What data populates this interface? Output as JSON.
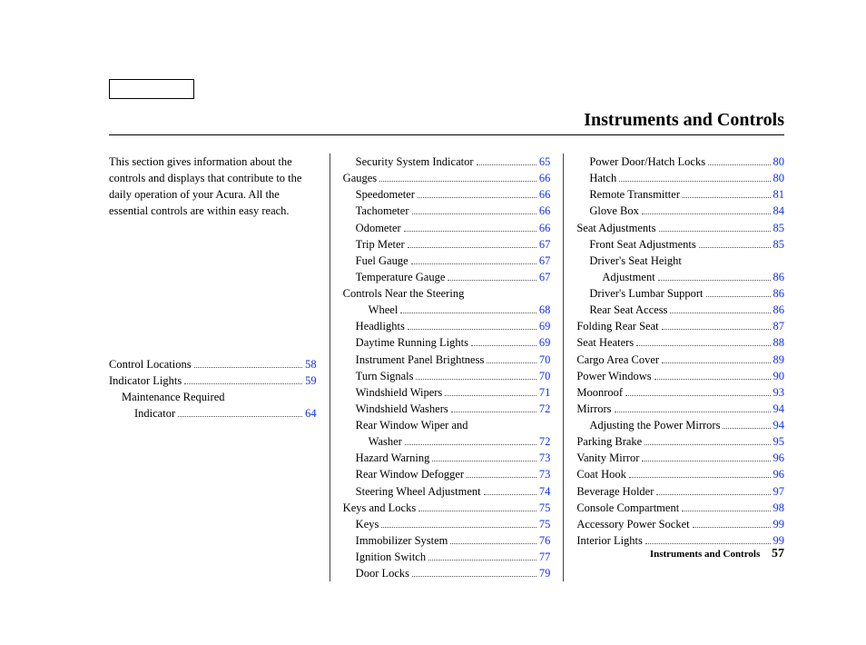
{
  "title": "Instruments and Controls",
  "intro": "This section gives information about the controls and displays that contribute to the daily operation of your Acura. All the essential controls are within easy reach.",
  "footer": {
    "section": "Instruments and Controls",
    "page": "57"
  },
  "toc": {
    "col1": [
      {
        "label": "Control Locations",
        "page": "58",
        "indent": 0
      },
      {
        "label": "Indicator Lights",
        "page": "59",
        "indent": 0
      },
      {
        "label": "Maintenance Required",
        "indent": 1,
        "wrap": true
      },
      {
        "label": "Indicator",
        "page": "64",
        "indent": 2,
        "cont": true
      }
    ],
    "col2": [
      {
        "label": "Security System Indicator",
        "page": "65",
        "indent": 1
      },
      {
        "label": "Gauges",
        "page": "66",
        "indent": 0
      },
      {
        "label": "Speedometer",
        "page": "66",
        "indent": 1
      },
      {
        "label": "Tachometer",
        "page": "66",
        "indent": 1
      },
      {
        "label": "Odometer",
        "page": "66",
        "indent": 1
      },
      {
        "label": "Trip Meter",
        "page": "67",
        "indent": 1
      },
      {
        "label": "Fuel Gauge",
        "page": "67",
        "indent": 1
      },
      {
        "label": "Temperature Gauge",
        "page": "67",
        "indent": 1
      },
      {
        "label": "Controls Near the Steering",
        "indent": 0,
        "wrap": true
      },
      {
        "label": "Wheel",
        "page": "68",
        "indent": 2,
        "cont": true
      },
      {
        "label": "Headlights",
        "page": "69",
        "indent": 1
      },
      {
        "label": "Daytime Running Lights",
        "page": "69",
        "indent": 1
      },
      {
        "label": "Instrument Panel Brightness",
        "page": "70",
        "indent": 1
      },
      {
        "label": "Turn Signals",
        "page": "70",
        "indent": 1
      },
      {
        "label": "Windshield Wipers",
        "page": "71",
        "indent": 1
      },
      {
        "label": "Windshield Washers",
        "page": "72",
        "indent": 1
      },
      {
        "label": "Rear Window Wiper and",
        "indent": 1,
        "wrap": true
      },
      {
        "label": "Washer",
        "page": "72",
        "indent": 2,
        "cont": true
      },
      {
        "label": "Hazard Warning",
        "page": "73",
        "indent": 1
      },
      {
        "label": "Rear Window Defogger",
        "page": "73",
        "indent": 1
      },
      {
        "label": "Steering Wheel Adjustment",
        "page": "74",
        "indent": 1
      },
      {
        "label": "Keys and Locks",
        "page": "75",
        "indent": 0
      },
      {
        "label": "Keys",
        "page": "75",
        "indent": 1
      },
      {
        "label": "Immobilizer System",
        "page": "76",
        "indent": 1
      },
      {
        "label": "Ignition Switch",
        "page": "77",
        "indent": 1
      },
      {
        "label": "Door Locks",
        "page": "79",
        "indent": 1
      }
    ],
    "col3": [
      {
        "label": "Power Door/Hatch Locks",
        "page": "80",
        "indent": 1
      },
      {
        "label": "Hatch",
        "page": "80",
        "indent": 1
      },
      {
        "label": "Remote Transmitter",
        "page": "81",
        "indent": 1
      },
      {
        "label": "Glove Box",
        "page": "84",
        "indent": 1
      },
      {
        "label": "Seat Adjustments",
        "page": "85",
        "indent": 0
      },
      {
        "label": "Front Seat Adjustments",
        "page": "85",
        "indent": 1
      },
      {
        "label": "Driver's Seat Height",
        "indent": 1,
        "wrap": true
      },
      {
        "label": "Adjustment",
        "page": "86",
        "indent": 2,
        "cont": true
      },
      {
        "label": "Driver's Lumbar Support",
        "page": "86",
        "indent": 1
      },
      {
        "label": "Rear Seat Access",
        "page": "86",
        "indent": 1
      },
      {
        "label": "Folding Rear Seat",
        "page": "87",
        "indent": 0
      },
      {
        "label": "Seat Heaters",
        "page": "88",
        "indent": 0
      },
      {
        "label": "Cargo Area Cover",
        "page": "89",
        "indent": 0
      },
      {
        "label": "Power Windows",
        "page": "90",
        "indent": 0
      },
      {
        "label": "Moonroof",
        "page": "93",
        "indent": 0
      },
      {
        "label": "Mirrors",
        "page": "94",
        "indent": 0
      },
      {
        "label": "Adjusting the Power Mirrors",
        "page": "94",
        "indent": 1
      },
      {
        "label": "Parking Brake",
        "page": "95",
        "indent": 0
      },
      {
        "label": "Vanity Mirror",
        "page": "96",
        "indent": 0
      },
      {
        "label": "Coat Hook",
        "page": "96",
        "indent": 0
      },
      {
        "label": "Beverage Holder",
        "page": "97",
        "indent": 0
      },
      {
        "label": "Console Compartment",
        "page": "98",
        "indent": 0
      },
      {
        "label": "Accessory Power Socket",
        "page": "99",
        "indent": 0
      },
      {
        "label": "Interior Lights",
        "page": "99",
        "indent": 0
      }
    ]
  }
}
